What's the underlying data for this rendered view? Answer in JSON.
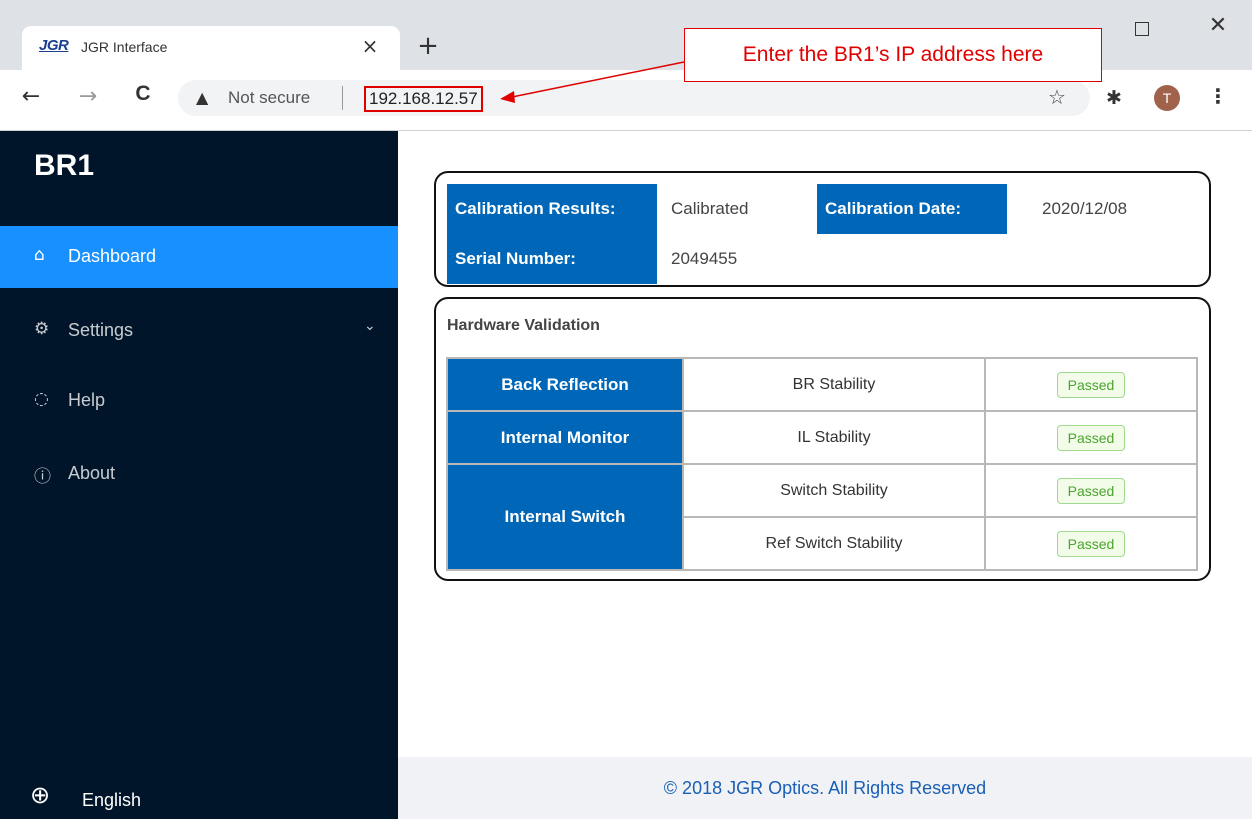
{
  "browser": {
    "tab_logo": "JGR",
    "tab_title": "JGR Interface",
    "tab_close": "×",
    "new_tab": "+",
    "win_close": "✕",
    "back": "←",
    "forward": "→",
    "reload": "C",
    "warning": "▲",
    "not_secure": "Not secure",
    "url": "192.168.12.57",
    "star": "☆",
    "extensions": "✱",
    "avatar_letter": "T",
    "menu": "⋮"
  },
  "annotation": {
    "text": "Enter the BR1’s IP address here",
    "color": "#e00000"
  },
  "sidebar": {
    "brand": "BR1",
    "items": [
      {
        "label": "Dashboard",
        "icon": "⌂",
        "active": true
      },
      {
        "label": "Settings",
        "icon": "⚙",
        "caret": "⌄"
      },
      {
        "label": "Help",
        "icon": "◌"
      },
      {
        "label": "About",
        "icon": "ⓘ"
      }
    ],
    "language": {
      "icon": "⊕",
      "label": "English"
    },
    "bg_color": "#001529",
    "active_color": "#1890ff"
  },
  "calibration": {
    "results_label": "Calibration Results:",
    "results_value": "Calibrated",
    "date_label": "Calibration Date:",
    "date_value": "2020/12/08",
    "serial_label": "Serial Number:",
    "serial_value": "2049455"
  },
  "hardware": {
    "title": "Hardware Validation",
    "rows": [
      {
        "group": "Back Reflection",
        "test": "BR Stability",
        "status": "Passed"
      },
      {
        "group": "Internal Monitor",
        "test": "IL Stability",
        "status": "Passed"
      },
      {
        "group": "Internal Switch",
        "test": "Switch Stability",
        "status": "Passed"
      },
      {
        "group": "",
        "test": "Ref Switch Stability",
        "status": "Passed"
      }
    ]
  },
  "footer": {
    "text": "© 2018 JGR Optics. All Rights Reserved"
  },
  "colors": {
    "header_blue": "#0067b8",
    "pass_green": "#4aa52e"
  }
}
